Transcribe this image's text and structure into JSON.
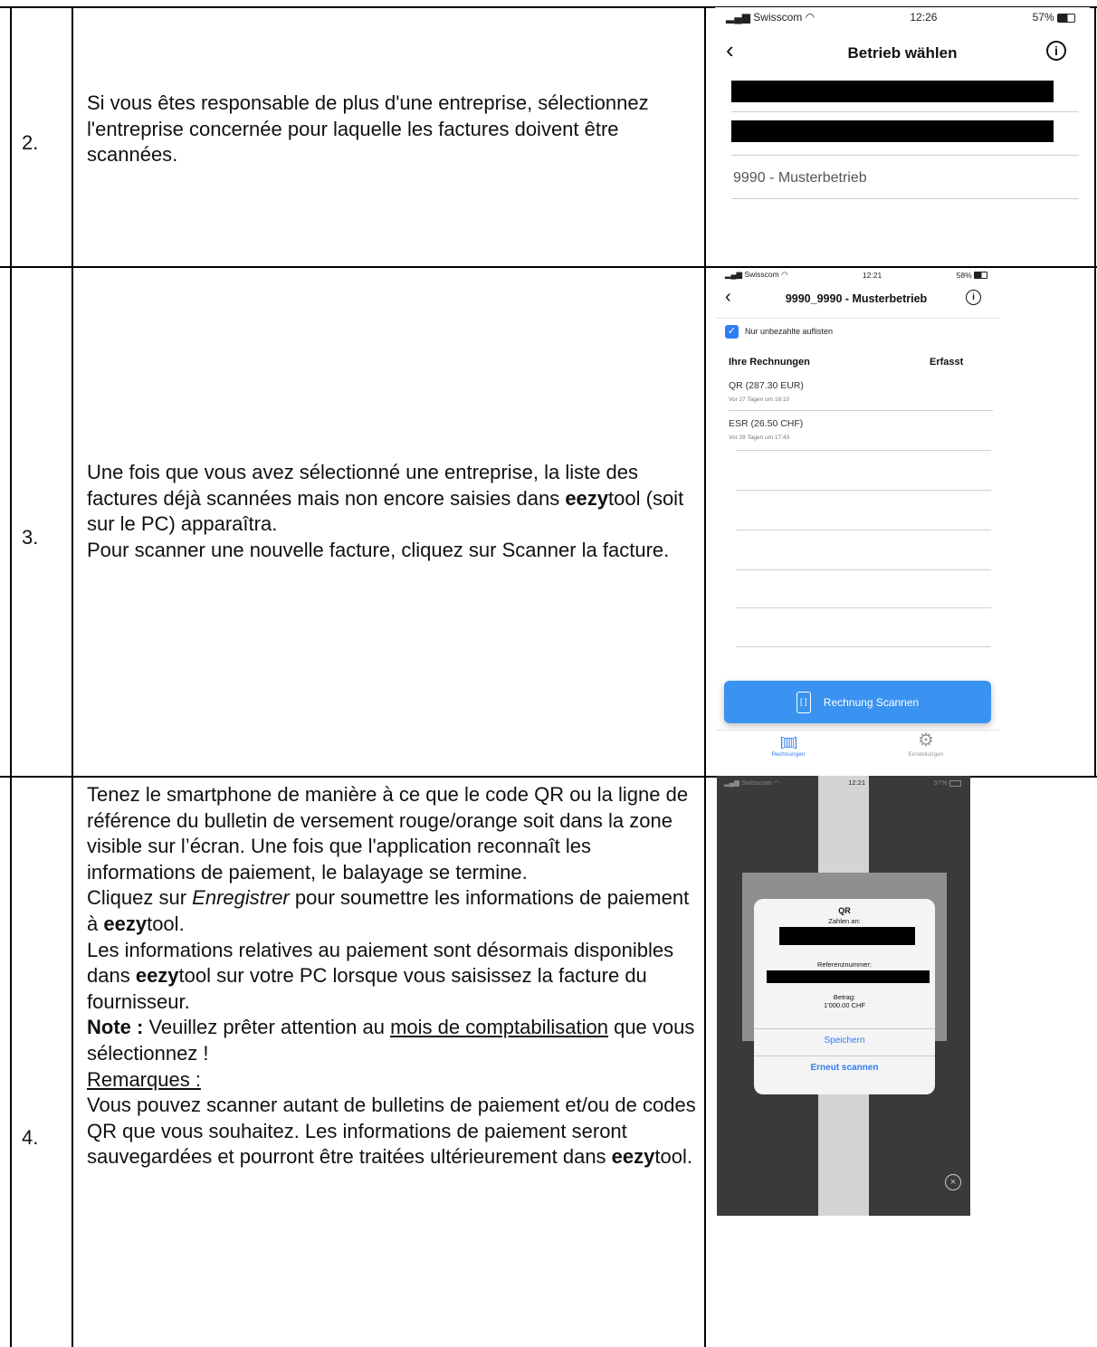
{
  "rows": [
    {
      "number": "2.",
      "text": "Si vous êtes responsable de plus d'une entreprise, sélectionnez l'entreprise concernée pour laquelle les factures doivent être scannées.",
      "screen": {
        "carrier": "Swisscom",
        "time": "12:26",
        "battery": "57%",
        "title": "Betrieb wählen",
        "item": "9990 - Musterbetrieb"
      }
    },
    {
      "number": "3.",
      "lines": [
        "Une fois que vous avez sélectionné une entreprise, la liste des factures déjà scannées mais non encore saisies dans ",
        "eezy",
        "tool (soit sur le PC) apparaîtra.",
        "Pour scanner une nouvelle facture, cliquez sur Scanner la facture."
      ],
      "screen": {
        "carrier": "Swisscom",
        "time": "12:21",
        "battery": "58%",
        "title": "9990_9990 - Musterbetrieb",
        "checkbox_label": "Nur unbezahlte auflisten",
        "col_left": "Ihre Rechnungen",
        "col_right": "Erfasst",
        "invoices": [
          {
            "name": "QR (287.30 EUR)",
            "meta": "Vor 27 Tagen um 16:10"
          },
          {
            "name": "ESR (26.50 CHF)",
            "meta": "Vor 28 Tagen um 17:43"
          }
        ],
        "scan_button": "Rechnung Scannen",
        "tab_left": "Rechnungen",
        "tab_right": "Einstellungen"
      }
    },
    {
      "number": "4.",
      "p1": "Tenez le smartphone de manière à ce que le code QR ou la ligne de référence du bulletin de versement rouge/orange soit dans la zone visible sur l’écran. Une fois que l'application reconnaît les informations de paiement, le balayage se termine.",
      "p2a": "Cliquez sur ",
      "p2b": "Enregistrer",
      "p2c": " pour soumettre les informations de paiement à ",
      "eezy": "eezy",
      "tool": "tool",
      "p3a": "Les informations relatives au paiement sont désormais disponibles dans ",
      "p3c": " sur votre PC lorsque vous saisissez la facture du fournisseur.",
      "note_label": "Note :",
      "note_a": " Veuillez prêter attention au ",
      "note_link": "mois de comptabilisation",
      "note_c": " que vous sélectionnez !",
      "remarks_label": "Remarques :",
      "p5a": "Vous pouvez scanner autant de bulletins de paiement et/ou de codes QR que vous souhaitez. Les informations de paiement seront sauvegardées et pourront être traitées ultérieurement dans ",
      "p5c": ".",
      "screen": {
        "carrier": "Swisscom",
        "time": "12:21",
        "battery": "57%",
        "dialog_title": "QR",
        "pay_to_label": "Zahlen an:",
        "ref_label": "Referenznummer:",
        "amount_label": "Betrag:",
        "amount": "1'000.00 CHF",
        "save": "Speichern",
        "rescan": "Erneut scannen"
      }
    }
  ],
  "colors": {
    "ios_blue": "#2f7df6",
    "scan_button": "#3a93f0",
    "dark_bg": "#3a3a3c"
  }
}
